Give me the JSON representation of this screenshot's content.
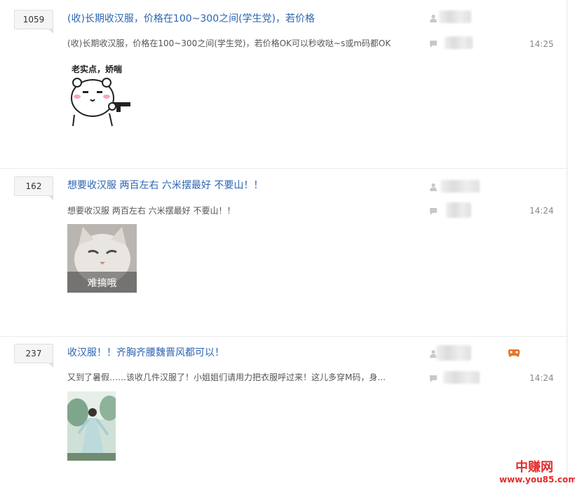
{
  "threads": [
    {
      "count": "1059",
      "title": "(收)长期收汉服，价格在100~300之间(学生党)，若价格",
      "excerpt": "(收)长期收汉服，价格在100~300之间(学生党)，若价格OK可以秒收哒~s或m码都OK",
      "time": "14:25",
      "image": {
        "kind": "sticker-bear",
        "caption": "老实点，娇喘"
      }
    },
    {
      "count": "162",
      "title": "想要收汉服 两百左右 六米摆最好 不要山！！",
      "excerpt": "想要收汉服 两百左右 六米摆最好 不要山！！",
      "time": "14:24",
      "image": {
        "kind": "photo-cat",
        "caption": "难搞哦"
      }
    },
    {
      "count": "237",
      "title": "收汉服！！齐胸齐腰魏晋风都可以！",
      "excerpt": "又到了暑假……该收几件汉服了！小姐姐们请用力把衣服呼过来！这儿多穿M码，身...",
      "time": "14:24",
      "image": {
        "kind": "photo-hanfu",
        "caption": ""
      },
      "badge_icon": "game-controller-icon"
    }
  ],
  "icons": {
    "author": "user-icon",
    "reply": "comment-icon"
  },
  "colors": {
    "title_link": "#2d64b3",
    "watermark": "#e32b2b"
  },
  "watermark": {
    "brand": "中赚网",
    "url": "www.you85.com"
  }
}
